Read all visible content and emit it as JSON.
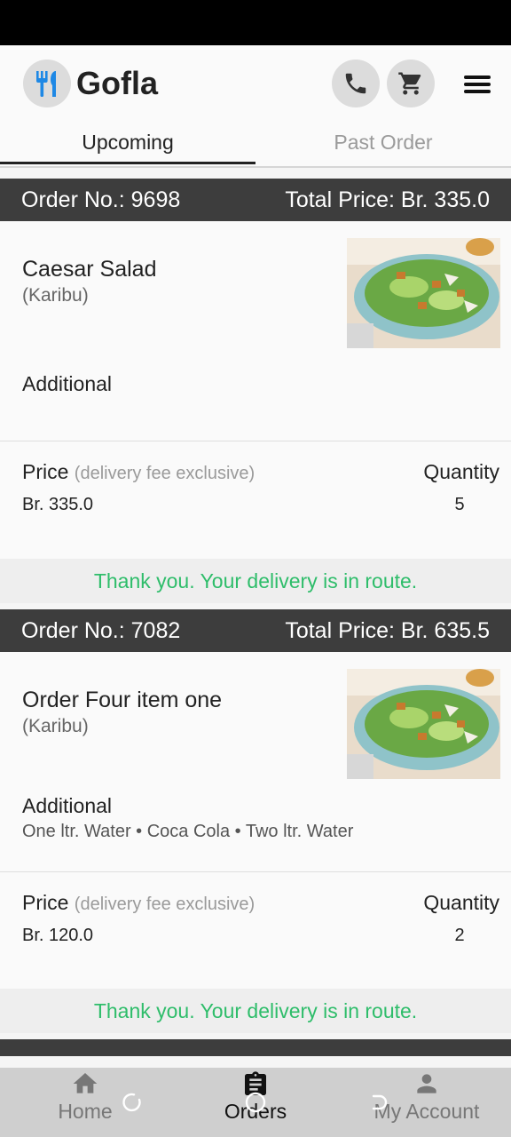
{
  "app": {
    "title": "Gofla"
  },
  "header_icons": {
    "logo": "fork-knife-icon",
    "call": "phone-icon",
    "cart": "cart-icon",
    "menu": "hamburger-menu-icon"
  },
  "tabs": [
    {
      "label": "Upcoming",
      "active": true
    },
    {
      "label": "Past Order",
      "active": false
    }
  ],
  "orders": [
    {
      "order_no": "Order No.: 9698",
      "total_price": "Total Price: Br. 335.0",
      "item_name": "Caesar Salad",
      "restaurant": "(Karibu)",
      "additional_label": "Additional",
      "additional_items": "",
      "price_label": "Price",
      "price_note": "(delivery fee exclusive)",
      "quantity_label": "Quantity",
      "price": "Br. 335.0",
      "quantity": "5",
      "status": "Thank you. Your delivery is in route."
    },
    {
      "order_no": "Order No.: 7082",
      "total_price": "Total Price: Br. 635.5",
      "item_name": "Order Four item one",
      "restaurant": "(Karibu)",
      "additional_label": "Additional",
      "additional_items": "One ltr. Water • Coca Cola • Two ltr. Water",
      "price_label": "Price",
      "price_note": "(delivery fee exclusive)",
      "quantity_label": "Quantity",
      "price": "Br. 120.0",
      "quantity": "2",
      "status": "Thank you. Your delivery is in route."
    }
  ],
  "bottom_nav": [
    {
      "label": "Home",
      "icon": "home-icon",
      "active": false
    },
    {
      "label": "Orders",
      "icon": "clipboard-icon",
      "active": true
    },
    {
      "label": "My Account",
      "icon": "person-icon",
      "active": false
    }
  ],
  "colors": {
    "accent_blue": "#1e88e5",
    "status_green": "#2ebd6a",
    "header_dark": "#3d3d3d"
  }
}
